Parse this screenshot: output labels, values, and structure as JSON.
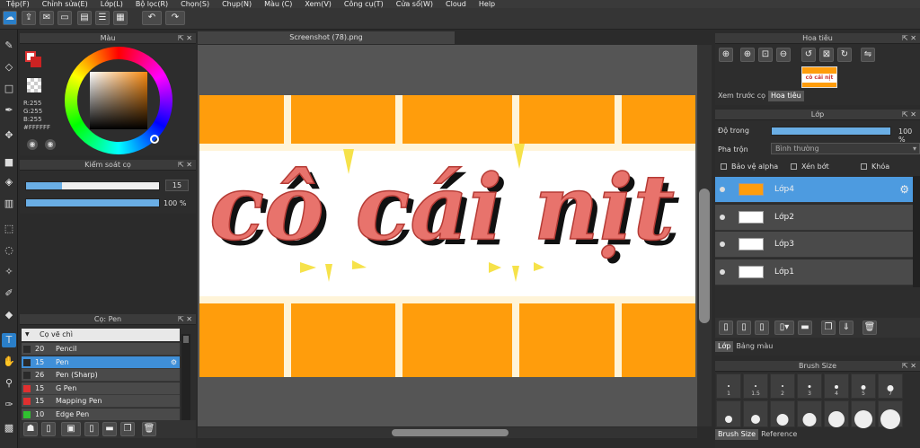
{
  "menu": [
    "Tệp(F)",
    "Chỉnh sửa(E)",
    "Lớp(L)",
    "Bộ lọc(R)",
    "Chọn(S)",
    "Chụp(N)",
    "Màu (C)",
    "Xem(V)",
    "Công cụ(T)",
    "Cửa sổ(W)",
    "Cloud",
    "Help"
  ],
  "document_tab": "Screenshot (78).png",
  "color_panel": {
    "title": "Màu",
    "r": "R:255",
    "g": "G:255",
    "b": "B:255",
    "hex": "#FFFFFF"
  },
  "brush_control": {
    "title": "Kiểm soát cọ",
    "size_value": "15",
    "size_fill": 0.27,
    "opacity_value": "100 %",
    "opacity_fill": 1.0
  },
  "brush_panel": {
    "title": "Cọ: Pen",
    "group": "Cọ vẽ chì",
    "items": [
      {
        "size": "20",
        "name": "Pencil",
        "color": "#2a2a2a"
      },
      {
        "size": "15",
        "name": "Pen",
        "color": "#2a2a2a",
        "selected": true
      },
      {
        "size": "26",
        "name": "Pen (Sharp)",
        "color": "#2a2a2a"
      },
      {
        "size": "15",
        "name": "G Pen",
        "color": "#e03030"
      },
      {
        "size": "15",
        "name": "Mapping Pen",
        "color": "#e03030"
      },
      {
        "size": "10",
        "name": "Edge Pen",
        "color": "#30c030"
      }
    ]
  },
  "navigator": {
    "title": "Hoa tiêu",
    "tabs": [
      "Xem trước cọ",
      "Hoa tiêu"
    ],
    "thumb_text": "cô cái nịt"
  },
  "layer_panel": {
    "title": "Lớp",
    "opacity_label": "Độ trong",
    "opacity_value": "100 %",
    "opacity_fill": 1.0,
    "blend_label": "Pha trộn",
    "blend_value": "Bình thường",
    "opt1": "Bảo vệ alpha",
    "opt2": "Xén bớt",
    "opt3": "Khóa",
    "layers": [
      {
        "name": "Lớp4",
        "selected": true
      },
      {
        "name": "Lớp2"
      },
      {
        "name": "Lớp3"
      },
      {
        "name": "Lớp1"
      }
    ],
    "tabs": [
      "Lớp",
      "Bảng màu"
    ]
  },
  "brush_size": {
    "title": "Brush Size",
    "row1": [
      "1",
      "1.5",
      "2",
      "3",
      "4",
      "5",
      "7"
    ],
    "tabs": [
      "Brush Size",
      "Reference"
    ]
  },
  "canvas": {
    "text": "cô cái nịt"
  },
  "colors": {
    "accent": "#3f8fd8",
    "orange": "#ff9d0c",
    "letter": "#e8736c",
    "cream": "#fff4d8"
  }
}
